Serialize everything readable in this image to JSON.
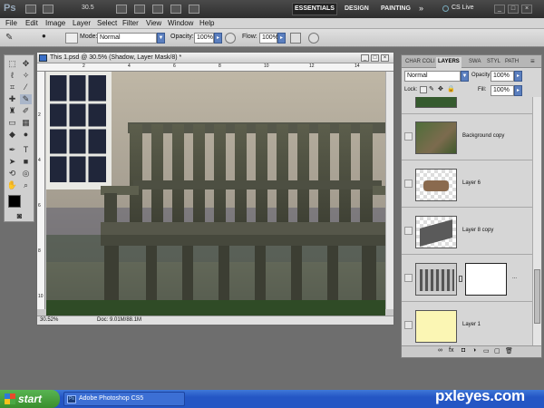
{
  "app": {
    "logo": "Ps",
    "zoom": "30.5",
    "workspaces": [
      "ESSENTIALS",
      "DESIGN",
      "PAINTING"
    ],
    "more": "»",
    "cslive": "CS Live"
  },
  "menu": [
    "File",
    "Edit",
    "Image",
    "Layer",
    "Select",
    "Filter",
    "View",
    "Window",
    "Help"
  ],
  "options": {
    "mode_label": "Mode:",
    "mode_value": "Normal",
    "opacity_label": "Opacity:",
    "opacity_value": "100%",
    "flow_label": "Flow:",
    "flow_value": "100%"
  },
  "document": {
    "title": "This 1.psd @ 30.5% (Shadow, Layer Mask/8) *",
    "zoom": "30.52%",
    "doc_info": "Doc: 9.01M/88.1M",
    "ruler_top": [
      "2",
      "4",
      "6",
      "8",
      "10",
      "12",
      "14"
    ],
    "ruler_left": [
      "2",
      "4",
      "6",
      "8",
      "10"
    ]
  },
  "layers_panel": {
    "tabs": [
      "CHAR COLI",
      "LAYERS",
      "SWA",
      "STYL",
      "PATH"
    ],
    "blend": "Normal",
    "opacity_label": "Opacity:",
    "opacity_value": "100%",
    "lock_label": "Lock:",
    "fill_label": "Fill:",
    "fill_value": "100%",
    "layers": [
      {
        "name": ""
      },
      {
        "name": "Background copy"
      },
      {
        "name": "Layer 6"
      },
      {
        "name": "Layer 8 copy"
      },
      {
        "name": ""
      },
      {
        "name": "Layer 1"
      }
    ],
    "mask_dots": "..."
  },
  "taskbar": {
    "start": "start",
    "task": "Adobe Photoshop CS5"
  },
  "watermark": "pxleyes.com"
}
